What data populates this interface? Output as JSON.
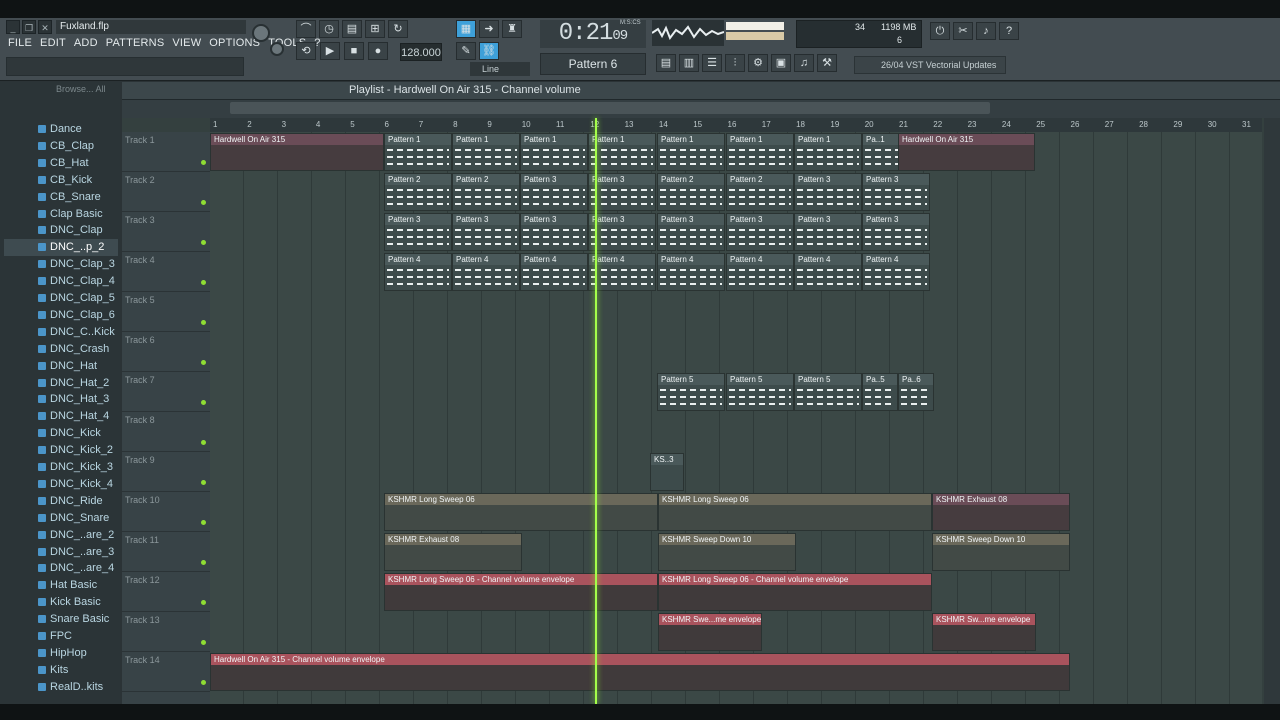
{
  "window": {
    "filename": "Fuxland.flp",
    "controls": [
      "_",
      "❐",
      "✕"
    ]
  },
  "menu": [
    "FILE",
    "EDIT",
    "ADD",
    "PATTERNS",
    "VIEW",
    "OPTIONS",
    "TOOLS",
    "?"
  ],
  "transport": {
    "time": "0:21",
    "time_sub": "09",
    "time_label": "M:S:CS",
    "tempo": "128.000",
    "pattern": "Pattern 6",
    "snap": "Line"
  },
  "cpu": {
    "value": "34",
    "memory": "1198 MB",
    "polyphony": "6"
  },
  "news": {
    "date": "26/04",
    "text": "VST Vectorial Updates"
  },
  "browser": {
    "header": "Browse... All",
    "items": [
      "Dance",
      "CB_Clap",
      "CB_Hat",
      "CB_Kick",
      "CB_Snare",
      "Clap Basic",
      "DNC_Clap",
      "DNC_..p_2",
      "DNC_Clap_3",
      "DNC_Clap_4",
      "DNC_Clap_5",
      "DNC_Clap_6",
      "DNC_C..Kick",
      "DNC_Crash",
      "DNC_Hat",
      "DNC_Hat_2",
      "DNC_Hat_3",
      "DNC_Hat_4",
      "DNC_Kick",
      "DNC_Kick_2",
      "DNC_Kick_3",
      "DNC_Kick_4",
      "DNC_Ride",
      "DNC_Snare",
      "DNC_..are_2",
      "DNC_..are_3",
      "DNC_..are_4",
      "Hat Basic",
      "Kick Basic",
      "Snare Basic",
      "FPC",
      "HipHop",
      "Kits",
      "RealD..kits"
    ]
  },
  "playlist": {
    "title": "Playlist - Hardwell On Air 315 - Channel volume",
    "ruler": [
      "1",
      "2",
      "3",
      "4",
      "5",
      "6",
      "7",
      "8",
      "9",
      "10",
      "11",
      "12",
      "13",
      "14",
      "15",
      "16",
      "17",
      "18",
      "19",
      "20",
      "21",
      "22",
      "23",
      "24",
      "25",
      "26",
      "27",
      "28",
      "29",
      "30",
      "31"
    ],
    "tracks": [
      "Track 1",
      "Track 2",
      "Track 3",
      "Track 4",
      "Track 5",
      "Track 6",
      "Track 7",
      "Track 8",
      "Track 9",
      "Track 10",
      "Track 11",
      "Track 12",
      "Track 13",
      "Track 14"
    ],
    "labels": {
      "audio_main": "Hardwell On Air 315",
      "p1": "Pattern 1",
      "p2": "Pattern 2",
      "p3": "Pattern 3",
      "p4": "Pattern 4",
      "p5": "Pattern 5",
      "pa1": "Pa..1",
      "pa5": "Pa..5",
      "pa6": "Pa..6",
      "ks3": "KS..3",
      "sweep06": "KSHMR Long Sweep 06",
      "exhaust08": "KSHMR Exhaust 08",
      "sweepdown10": "KSHMR Sweep Down 10",
      "env_sweep06": "KSHMR Long Sweep 06 - Channel volume envelope",
      "env_swe": "KSHMR Swe...me envelope",
      "env_sw": "KSHMR Sw...me envelope",
      "env_main": "Hardwell On Air 315 - Channel volume envelope"
    }
  }
}
